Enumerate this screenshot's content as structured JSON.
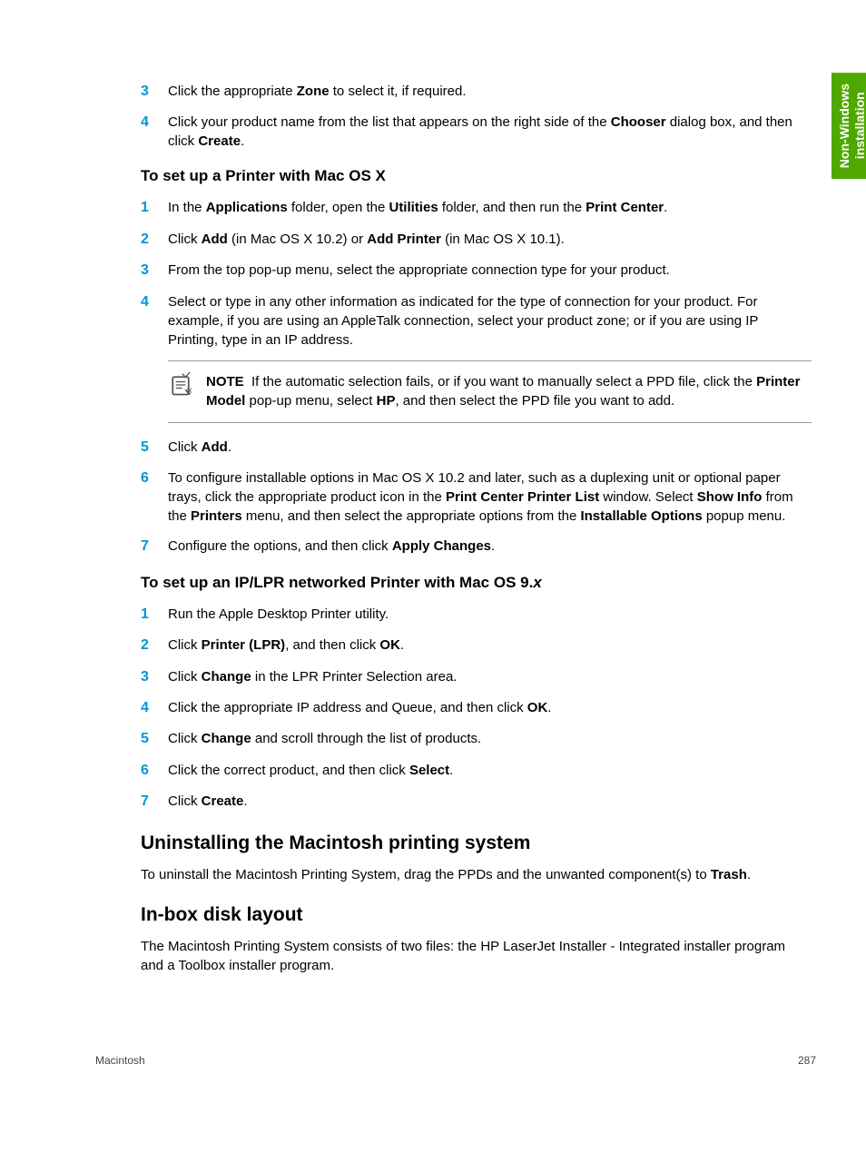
{
  "sideTab": {
    "line1": "Non-Windows",
    "line2": "installation"
  },
  "topList": [
    {
      "n": "3",
      "html": "Click the appropriate <b>Zone</b> to select it, if required."
    },
    {
      "n": "4",
      "html": "Click your product name from the list that appears on the right side of the <b>Chooser</b> dialog box, and then click <b>Create</b>."
    }
  ],
  "h3a": "To set up a Printer with Mac OS X",
  "listA": [
    {
      "n": "1",
      "html": "In the <b>Applications</b> folder, open the <b>Utilities</b> folder, and then run the <b>Print Center</b>."
    },
    {
      "n": "2",
      "html": "Click <b>Add</b> (in Mac OS X 10.2) or <b>Add Printer</b> (in Mac OS X 10.1)."
    },
    {
      "n": "3",
      "html": "From the top pop-up menu, select the appropriate connection type for your product."
    },
    {
      "n": "4",
      "html": "Select or type in any other information as indicated for the type of connection for your product. For example, if you are using an AppleTalk connection, select your product zone; or if you are using IP Printing, type in an IP address."
    }
  ],
  "note": {
    "label": "NOTE",
    "html": "If the automatic selection fails, or if you want to manually select a PPD file, click the <b>Printer Model</b> pop-up menu, select <b>HP</b>, and then select the PPD file you want to add."
  },
  "listA2": [
    {
      "n": "5",
      "html": "Click <b>Add</b>."
    },
    {
      "n": "6",
      "html": "To configure installable options in Mac OS X 10.2 and later, such as a duplexing unit or optional paper trays, click the appropriate product icon in the <b>Print Center Printer List</b> window. Select <b>Show Info</b> from the <b>Printers</b> menu, and then select the appropriate options from the <b>Installable Options</b> popup menu."
    },
    {
      "n": "7",
      "html": "Configure the options, and then click <b>Apply Changes</b>."
    }
  ],
  "h3b_pre": "To set up an IP/LPR networked Printer with Mac OS 9.",
  "h3b_it": "x",
  "listB": [
    {
      "n": "1",
      "html": "Run the Apple Desktop Printer utility."
    },
    {
      "n": "2",
      "html": "Click <b>Printer (LPR)</b>, and then click <b>OK</b>."
    },
    {
      "n": "3",
      "html": "Click <b>Change</b> in the LPR Printer Selection area."
    },
    {
      "n": "4",
      "html": "Click the appropriate IP address and Queue, and then click <b>OK</b>."
    },
    {
      "n": "5",
      "html": "Click <b>Change</b> and scroll through the list of products."
    },
    {
      "n": "6",
      "html": "Click the correct product, and then click <b>Select</b>."
    },
    {
      "n": "7",
      "html": "Click <b>Create</b>."
    }
  ],
  "h2a": "Uninstalling the Macintosh printing system",
  "pA": "To uninstall the Macintosh Printing System, drag the PPDs and the unwanted component(s) to <b>Trash</b>.",
  "h2b": "In-box disk layout",
  "pB": "The Macintosh Printing System consists of two files: the HP LaserJet Installer - Integrated installer program and a Toolbox installer program.",
  "footer": {
    "left": "Macintosh",
    "right": "287"
  }
}
